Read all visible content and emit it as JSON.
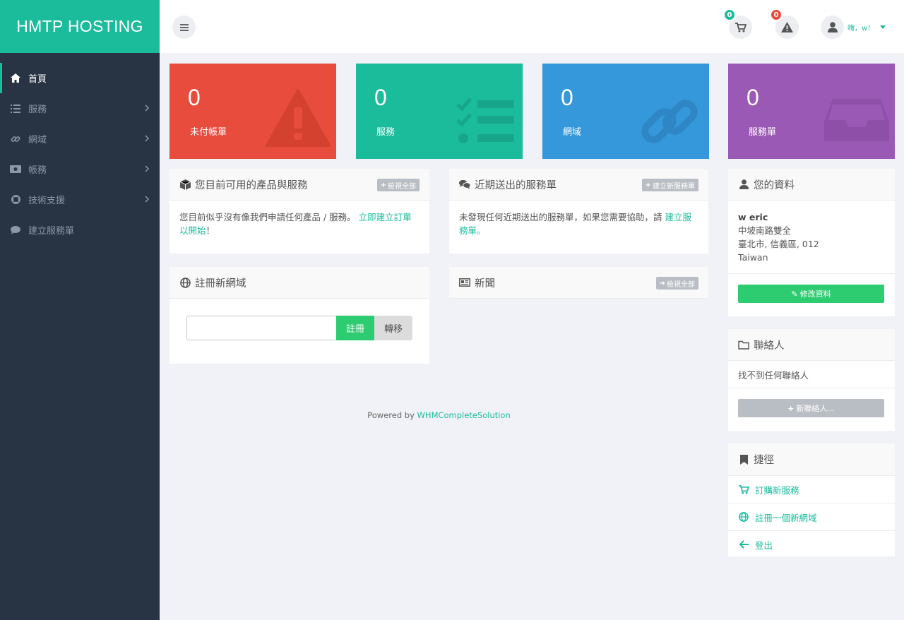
{
  "brand": "HMTP HOSTING",
  "sidebar": {
    "items": [
      {
        "label": "首頁",
        "icon": "home-icon"
      },
      {
        "label": "服務",
        "icon": "list-icon"
      },
      {
        "label": "網域",
        "icon": "link-icon"
      },
      {
        "label": "帳務",
        "icon": "money-icon"
      },
      {
        "label": "技術支援",
        "icon": "lifering-icon"
      },
      {
        "label": "建立服務單",
        "icon": "comment-icon"
      }
    ]
  },
  "header": {
    "cart_count": "0",
    "alert_count": "0",
    "user_label": "嗨，w！"
  },
  "tiles": [
    {
      "count": "0",
      "label": "未付帳單",
      "color": "#e84c3d"
    },
    {
      "count": "0",
      "label": "服務",
      "color": "#1abc9c"
    },
    {
      "count": "0",
      "label": "網域",
      "color": "#3598db"
    },
    {
      "count": "0",
      "label": "服務單",
      "color": "#9b59b6"
    }
  ],
  "products_panel": {
    "title": "您目前可用的產品與服務",
    "button": "檢視全部",
    "text": "您目前似乎沒有像我們申請任何產品 / 服務。",
    "link": "立即建立訂單以開始",
    "suffix": "！"
  },
  "tickets_panel": {
    "title": "近期送出的服務單",
    "button": "建立新服務單",
    "text": "未發現任何近期送出的服務單，如果您需要協助，請",
    "link": "建立服務單",
    "suffix": "。"
  },
  "domain_panel": {
    "title": "註冊新網域",
    "register": "註冊",
    "transfer": "轉移"
  },
  "news_panel": {
    "title": "新聞",
    "button": "檢視全部"
  },
  "footer": {
    "text": "Powered by",
    "link": "WHMCompleteSolution"
  },
  "profile": {
    "title": "您的資料",
    "name": "w eric",
    "line1": "中坡南路雙全",
    "line2": "臺北市, 信義區, 012",
    "line3": "Taiwan",
    "edit": "修改資料"
  },
  "contacts": {
    "title": "聯絡人",
    "empty": "找不到任何聯絡人",
    "new": "新聯絡人..."
  },
  "shortcuts": {
    "title": "捷徑",
    "items": [
      {
        "label": "訂購新服務",
        "icon": "cart-icon"
      },
      {
        "label": "註冊一個新網域",
        "icon": "globe-icon"
      },
      {
        "label": "登出",
        "icon": "arrow-left-icon"
      }
    ]
  },
  "colors": {
    "accent": "#1abc9c",
    "sidebar": "#283443",
    "success": "#2ecc71",
    "danger": "#e74c3c"
  }
}
